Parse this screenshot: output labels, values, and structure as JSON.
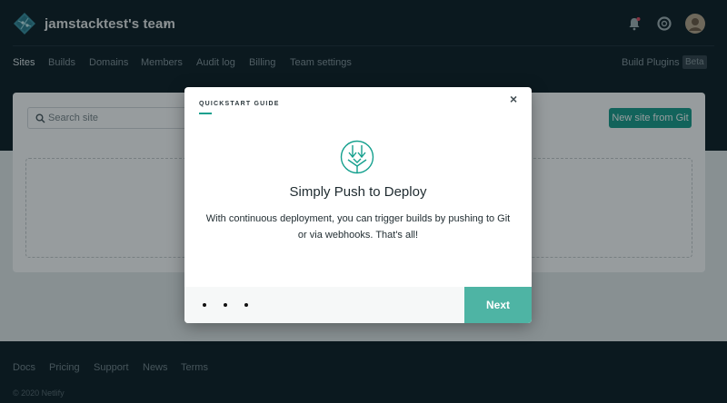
{
  "header": {
    "team_name": "jamstacktest's team",
    "icons": [
      "notifications-icon",
      "help-icon",
      "user-avatar"
    ]
  },
  "nav": {
    "items": [
      {
        "label": "Sites",
        "active": true
      },
      {
        "label": "Builds",
        "active": false
      },
      {
        "label": "Domains",
        "active": false
      },
      {
        "label": "Members",
        "active": false
      },
      {
        "label": "Audit log",
        "active": false
      },
      {
        "label": "Billing",
        "active": false
      },
      {
        "label": "Team settings",
        "active": false
      }
    ],
    "build_plugins": "Build Plugins",
    "beta_badge": "Beta"
  },
  "sites": {
    "search_placeholder": "Search site",
    "new_site_button": "New site from Git"
  },
  "modal": {
    "label": "QUICKSTART GUIDE",
    "close": "×",
    "title": "Simply Push to Deploy",
    "body": "With continuous deployment, you can trigger builds by pushing to Git or via webhooks. That's all!",
    "next_button": "Next",
    "step_dots": 3
  },
  "footer": {
    "links": [
      "Docs",
      "Pricing",
      "Support",
      "News",
      "Terms"
    ],
    "copyright": "© 2020 Netlify"
  },
  "colors": {
    "dark_bg": "#0e1e25",
    "accent": "#1b9e8c",
    "next_button": "#4eb4a4"
  }
}
